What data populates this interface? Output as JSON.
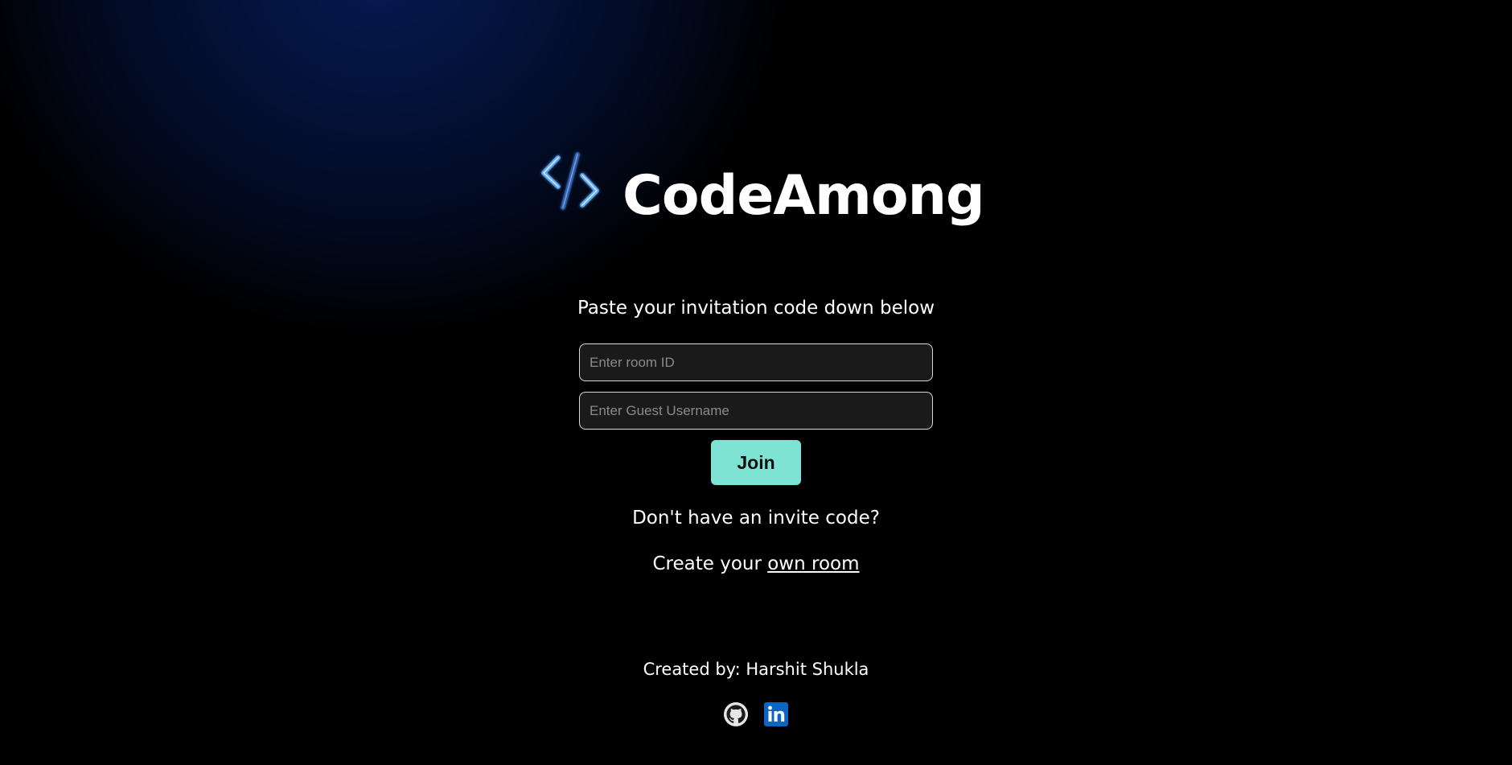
{
  "brand": {
    "name": "CodeAmong",
    "icon": "code-brackets-icon",
    "accent_color": "#4a9cf0"
  },
  "join_form": {
    "subtitle": "Paste your invitation code down below",
    "room_id_placeholder": "Enter room ID",
    "room_id_value": "",
    "username_placeholder": "Enter Guest Username",
    "username_value": "",
    "join_label": "Join",
    "join_color": "#7fe3d4"
  },
  "create_room": {
    "prompt": "Don't have an invite code?",
    "lead_text": "Create your ",
    "link_text": "own room"
  },
  "footer": {
    "credit": "Created by: Harshit Shukla",
    "socials": [
      {
        "icon": "github-icon"
      },
      {
        "icon": "linkedin-icon"
      }
    ]
  }
}
